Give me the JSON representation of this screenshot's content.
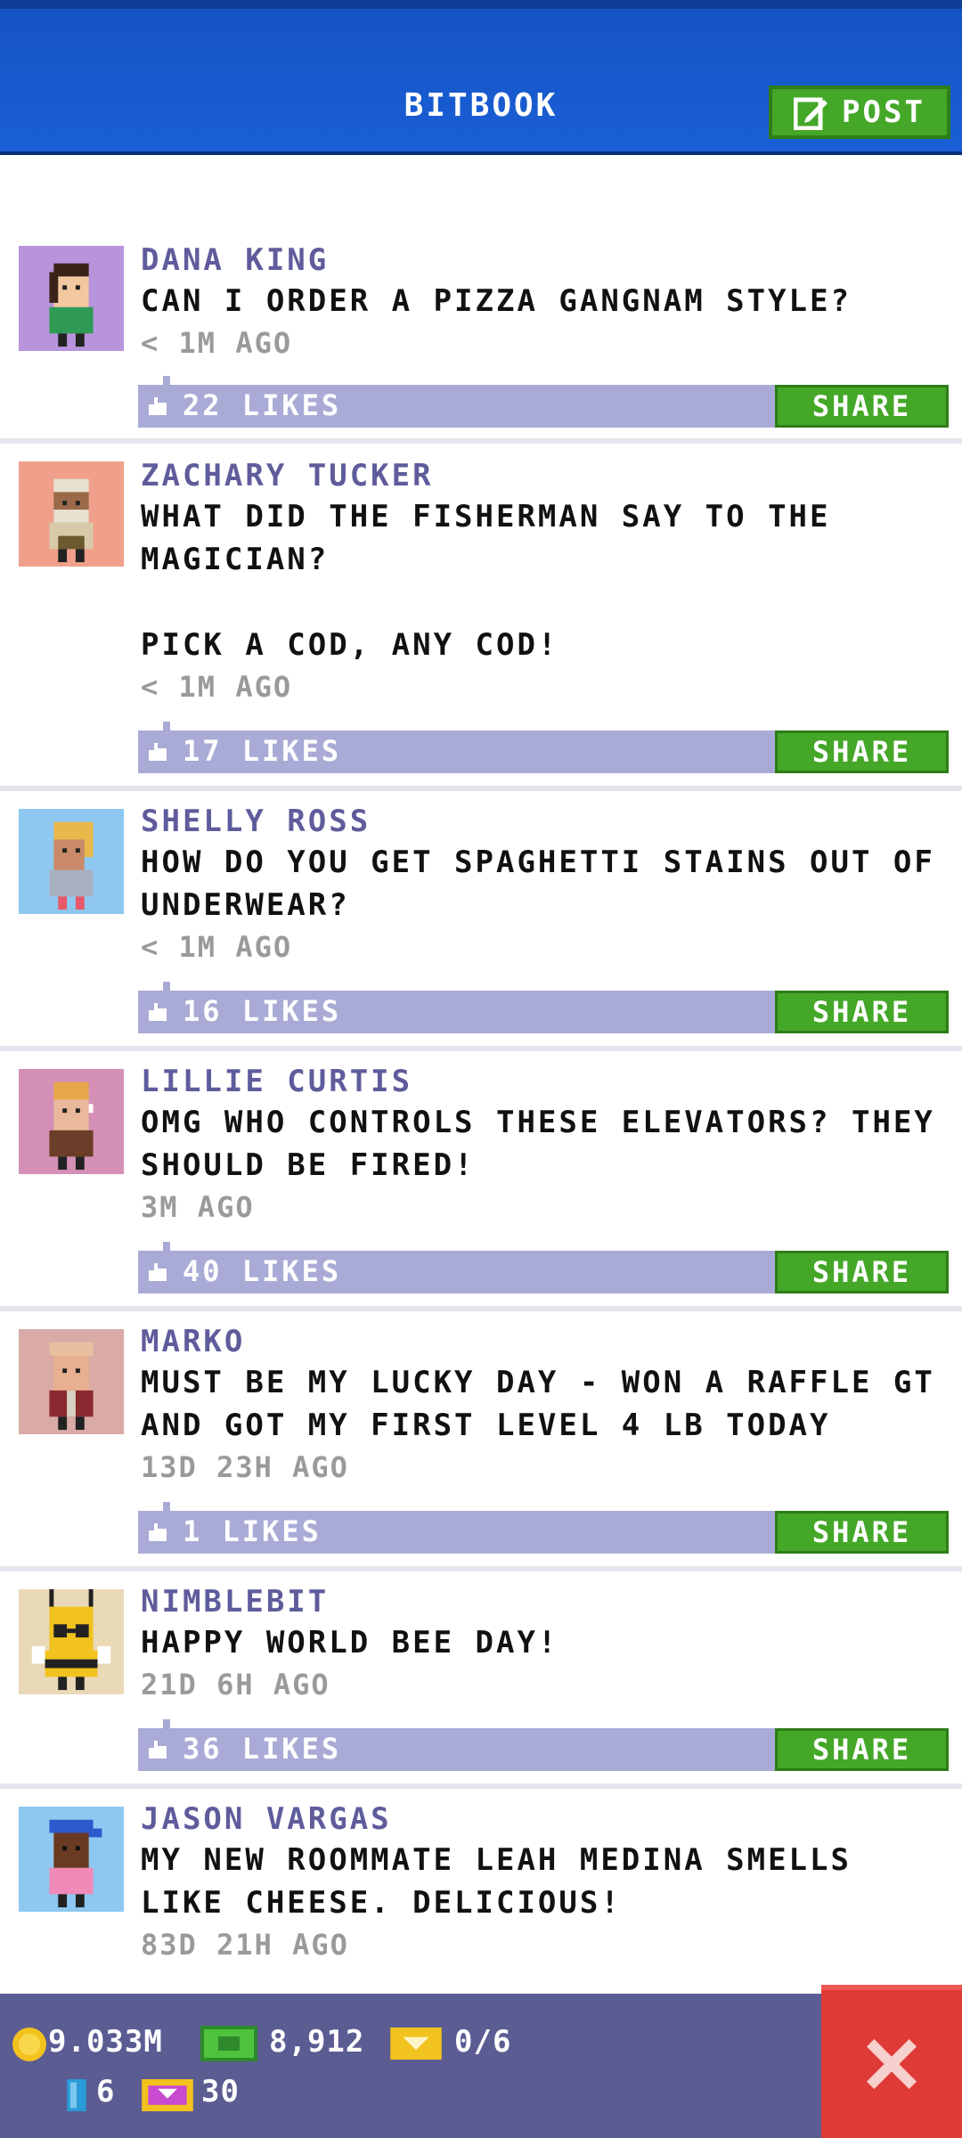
{
  "header": {
    "title": "BITBOOK",
    "post_label": "POST"
  },
  "posts": [
    {
      "name": "DANA KING",
      "body": "CAN I ORDER A PIZZA GANGNAM STYLE?",
      "time": "< 1M AGO",
      "likes": "22 LIKES",
      "share": "SHARE",
      "avatar_color": "#b794dc"
    },
    {
      "name": "ZACHARY TUCKER",
      "body": "WHAT DID THE FISHERMAN SAY TO THE MAGICIAN?\n\nPICK A COD, ANY COD!",
      "time": "< 1M AGO",
      "likes": "17 LIKES",
      "share": "SHARE",
      "avatar_color": "#f0a08a"
    },
    {
      "name": "SHELLY ROSS",
      "body": "HOW DO YOU GET SPAGHETTI STAINS OUT OF UNDERWEAR?",
      "time": "< 1M AGO",
      "likes": "16 LIKES",
      "share": "SHARE",
      "avatar_color": "#8ec8f0"
    },
    {
      "name": "LILLIE CURTIS",
      "body": "OMG WHO CONTROLS THESE ELEVATORS? THEY SHOULD BE FIRED!",
      "time": "3M AGO",
      "likes": "40 LIKES",
      "share": "SHARE",
      "avatar_color": "#d490b6"
    },
    {
      "name": "MARKO",
      "body": "MUST BE MY LUCKY DAY - WON A RAFFLE GT AND GOT MY FIRST LEVEL 4 LB TODAY",
      "time": "13D 23H AGO",
      "likes": "1 LIKES",
      "share": "SHARE",
      "avatar_color": "#d9aaa6"
    },
    {
      "name": "NIMBLEBIT",
      "body": "HAPPY WORLD BEE DAY!",
      "time": "21D 6H AGO",
      "likes": "36 LIKES",
      "share": "SHARE",
      "avatar_color": "#ead9b6"
    },
    {
      "name": "JASON VARGAS",
      "body": "MY NEW ROOMMATE LEAH MEDINA SMELLS LIKE CHEESE. DELICIOUS!",
      "time": "83D 21H AGO",
      "likes": "",
      "share": "",
      "avatar_color": "#8ec8f0"
    }
  ],
  "footer": {
    "coins": "9.033M",
    "bux": "8,912",
    "tickets": "0/6",
    "keys": "6",
    "vip": "30"
  },
  "colors": {
    "accent_green": "#44a728",
    "header_blue": "#1553c4",
    "likes_bar": "#a9abd6",
    "name_purple": "#5f5c9c"
  }
}
